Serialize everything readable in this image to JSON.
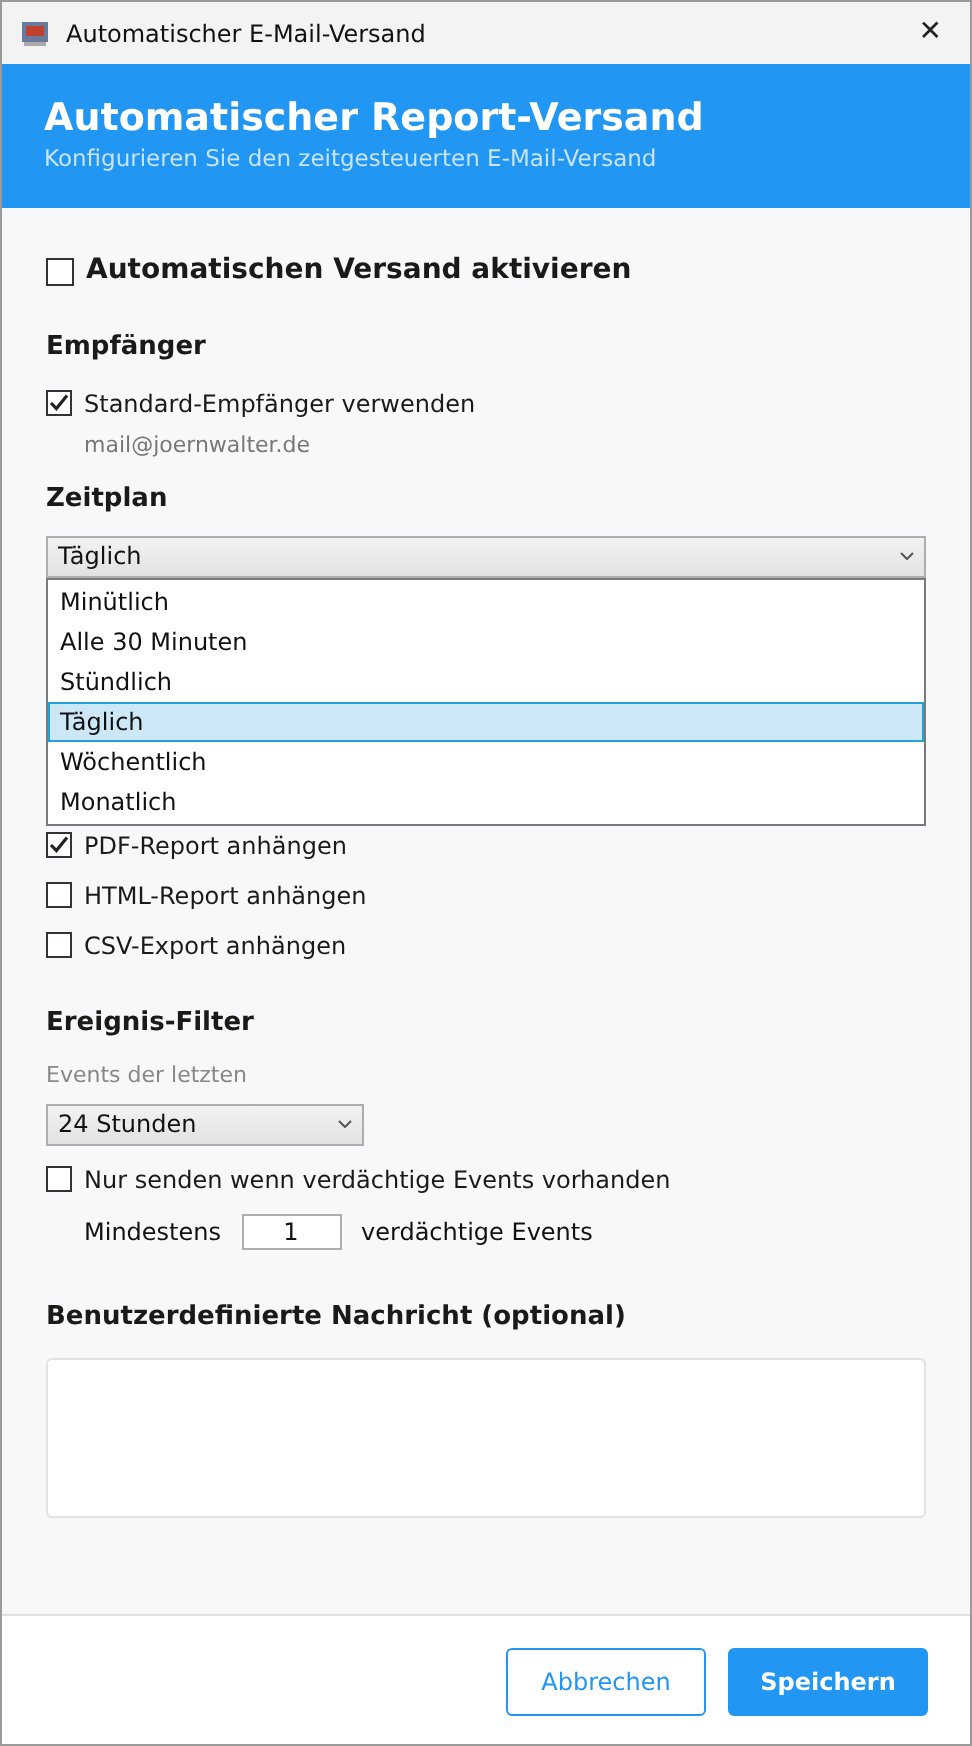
{
  "window": {
    "title": "Automatischer E-Mail-Versand",
    "close": "✕"
  },
  "header": {
    "title": "Automatischer Report-Versand",
    "subtitle": "Konfigurieren Sie den zeitgesteuerten E-Mail-Versand"
  },
  "enable": {
    "label": "Automatischen Versand aktivieren",
    "checked": false
  },
  "recipients": {
    "heading": "Empfänger",
    "use_default": {
      "label": "Standard-Empfänger verwenden",
      "checked": true
    },
    "address": "mail@joernwalter.de"
  },
  "schedule": {
    "heading": "Zeitplan",
    "value": "Täglich",
    "expanded": true,
    "options": [
      {
        "label": "Minütlich",
        "selected": false
      },
      {
        "label": "Alle 30 Minuten",
        "selected": false
      },
      {
        "label": "Stündlich",
        "selected": false
      },
      {
        "label": "Täglich",
        "selected": true
      },
      {
        "label": "Wöchentlich",
        "selected": false
      },
      {
        "label": "Monatlich",
        "selected": false
      }
    ]
  },
  "attachments": [
    {
      "label": "PDF-Report anhängen",
      "checked": true
    },
    {
      "label": "HTML-Report anhängen",
      "checked": false
    },
    {
      "label": "CSV-Export anhängen",
      "checked": false
    }
  ],
  "filter": {
    "heading": "Ereignis-Filter",
    "period_label": "Events der letzten",
    "period": "24 Stunden",
    "only_suspicious": {
      "label": "Nur senden wenn verdächtige Events vorhanden",
      "checked": false
    },
    "min_prefix": "Mindestens",
    "min_value": "1",
    "min_suffix": "verdächtige Events"
  },
  "message": {
    "heading": "Benutzerdefinierte Nachricht (optional)"
  },
  "buttons": [
    {
      "label": "Abbrechen",
      "kind": "secondary"
    },
    {
      "label": "Speichern",
      "kind": "primary"
    }
  ]
}
